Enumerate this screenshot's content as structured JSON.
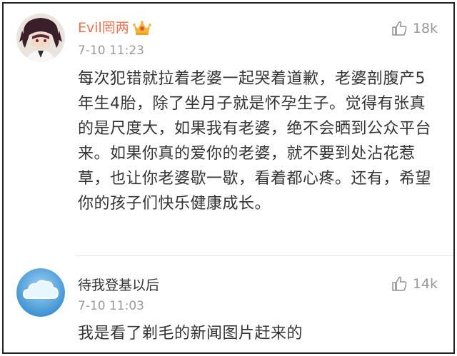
{
  "comments": [
    {
      "username": "Evil罔两",
      "badge_icon": "vip-crown-icon",
      "timestamp": "7-10 11:23",
      "like_icon": "thumbs-up-icon",
      "like_count": "18k",
      "text": "每次犯错就拉着老婆一起哭着道歉，老婆剖腹产5年生4胎，除了坐月子就是怀孕生子。觉得有张真的是尺度大，如果我有老婆，绝不会晒到公众平台来。如果你真的爱你的老婆，就不要到处沾花惹草，也让你老婆歇一歇，看着都心疼。还有，希望你的孩子们快乐健康成长。",
      "name_color": "#eb7350"
    },
    {
      "username": "待我登基以后",
      "timestamp": "7-10 11:03",
      "like_icon": "thumbs-up-icon",
      "like_count": "14k",
      "text": "我是看了剃毛的新闻图片赶来的"
    }
  ]
}
